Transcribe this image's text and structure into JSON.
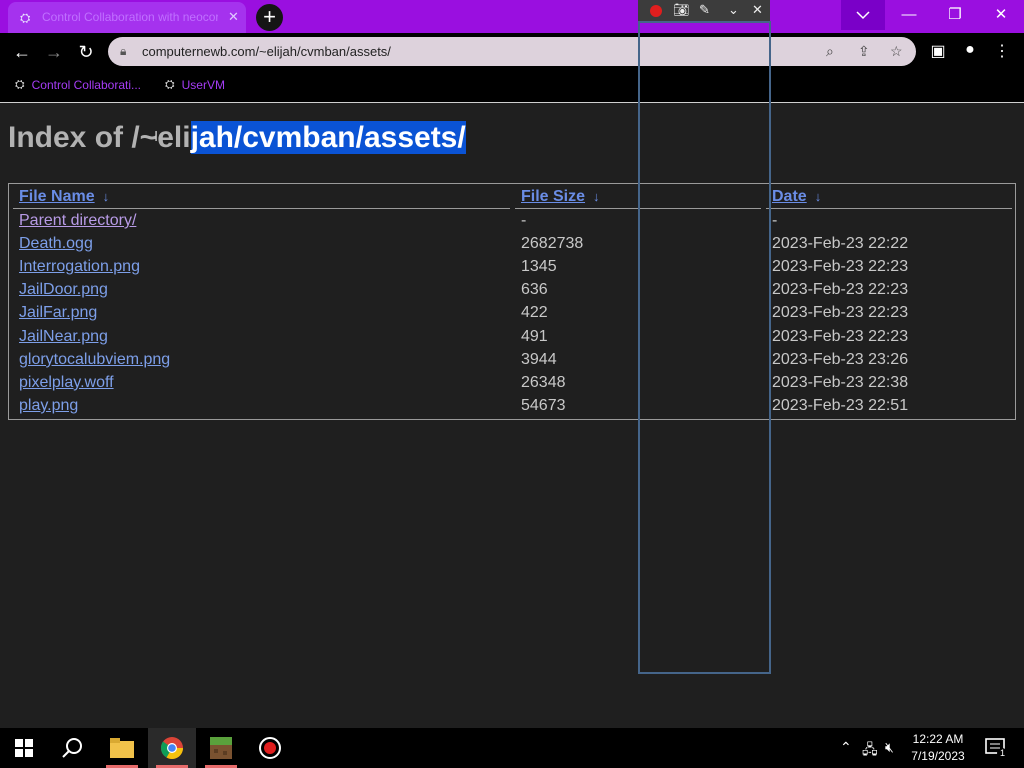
{
  "browser": {
    "tab_title": "Control Collaboration with neocortex",
    "url": "computernewb.com/~elijah/cvmban/assets/",
    "bookmarks": [
      {
        "label": "Control Collaborati..."
      },
      {
        "label": "UserVM"
      }
    ],
    "colors": {
      "titlebar": "#9a0fe0",
      "bookmark_text": "#a53cf5"
    }
  },
  "page": {
    "heading_prefix": "Index of /~eli",
    "heading_selected": "jah/cvmban/assets/",
    "columns": {
      "name": "File Name",
      "size": "File Size",
      "date": "Date",
      "sort_arrow": "↓"
    },
    "rows": [
      {
        "name": "Parent directory/",
        "size": "-",
        "date": "-"
      },
      {
        "name": "Death.ogg",
        "size": "2682738",
        "date": "2023-Feb-23 22:22"
      },
      {
        "name": "Interrogation.png",
        "size": "1345",
        "date": "2023-Feb-23 22:23"
      },
      {
        "name": "JailDoor.png",
        "size": "636",
        "date": "2023-Feb-23 22:23"
      },
      {
        "name": "JailFar.png",
        "size": "422",
        "date": "2023-Feb-23 22:23"
      },
      {
        "name": "JailNear.png",
        "size": "491",
        "date": "2023-Feb-23 22:23"
      },
      {
        "name": "glorytocalubviem.png",
        "size": "3944",
        "date": "2023-Feb-23 23:26"
      },
      {
        "name": "pixelplay.woff",
        "size": "26348",
        "date": "2023-Feb-23 22:38"
      },
      {
        "name": "play.png",
        "size": "54673",
        "date": "2023-Feb-23 22:51"
      }
    ]
  },
  "taskbar": {
    "time": "12:22 AM",
    "date": "7/19/2023",
    "notification_count": "1"
  }
}
